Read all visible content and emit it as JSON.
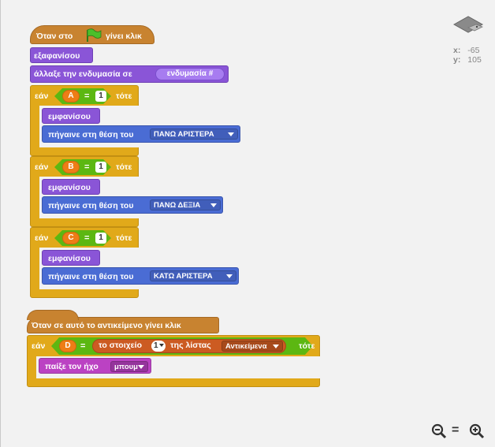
{
  "coords": {
    "x_label": "x:",
    "x_value": "-65",
    "y_label": "y:",
    "y_value": "105"
  },
  "script1": {
    "hat": "Όταν στο",
    "hat_tail": "γίνει κλικ",
    "hide": "εξαφανίσου",
    "switch_costume": "άλλαξε την ενδυμασία σε",
    "costume_value": "ενδυμασία #",
    "if_blocks": [
      {
        "if_label": "εάν",
        "var": "A",
        "eq": "=",
        "value": "1",
        "then": "τότε",
        "show": "εμφανίσου",
        "goto": "πήγαινε στη θέση του",
        "position": "ΠΑΝΩ ΑΡΙΣΤΕΡΑ"
      },
      {
        "if_label": "εάν",
        "var": "B",
        "eq": "=",
        "value": "1",
        "then": "τότε",
        "show": "εμφανίσου",
        "goto": "πήγαινε στη θέση του",
        "position": "ΠΑΝΩ ΔΕΞΙΑ"
      },
      {
        "if_label": "εάν",
        "var": "C",
        "eq": "=",
        "value": "1",
        "then": "τότε",
        "show": "εμφανίσου",
        "goto": "πήγαινε στη θέση του",
        "position": "ΚΑΤΩ ΑΡΙΣΤΕΡΑ"
      }
    ]
  },
  "script2": {
    "hat": "Όταν σε αυτό το αντικείμενο γίνει κλικ",
    "if_label": "εάν",
    "var": "D",
    "eq": "=",
    "item_label": "το στοιχείο",
    "item_index": "1",
    "of_list": "της λίστας",
    "list_name": "Αντικείμενα",
    "then": "τότε",
    "play_sound": "παίξε τον ήχο",
    "sound_name": "μπουμ"
  },
  "zoom": {
    "out": "−",
    "reset": "=",
    "in": "+"
  },
  "colors": {
    "events": "#c88330",
    "looks": "#8a55d7",
    "motion": "#4a6cd4",
    "control": "#e1a91a",
    "sound": "#bb42c3",
    "operator": "#5cb712",
    "variable": "#ee7d16",
    "list": "#cc5b22"
  }
}
